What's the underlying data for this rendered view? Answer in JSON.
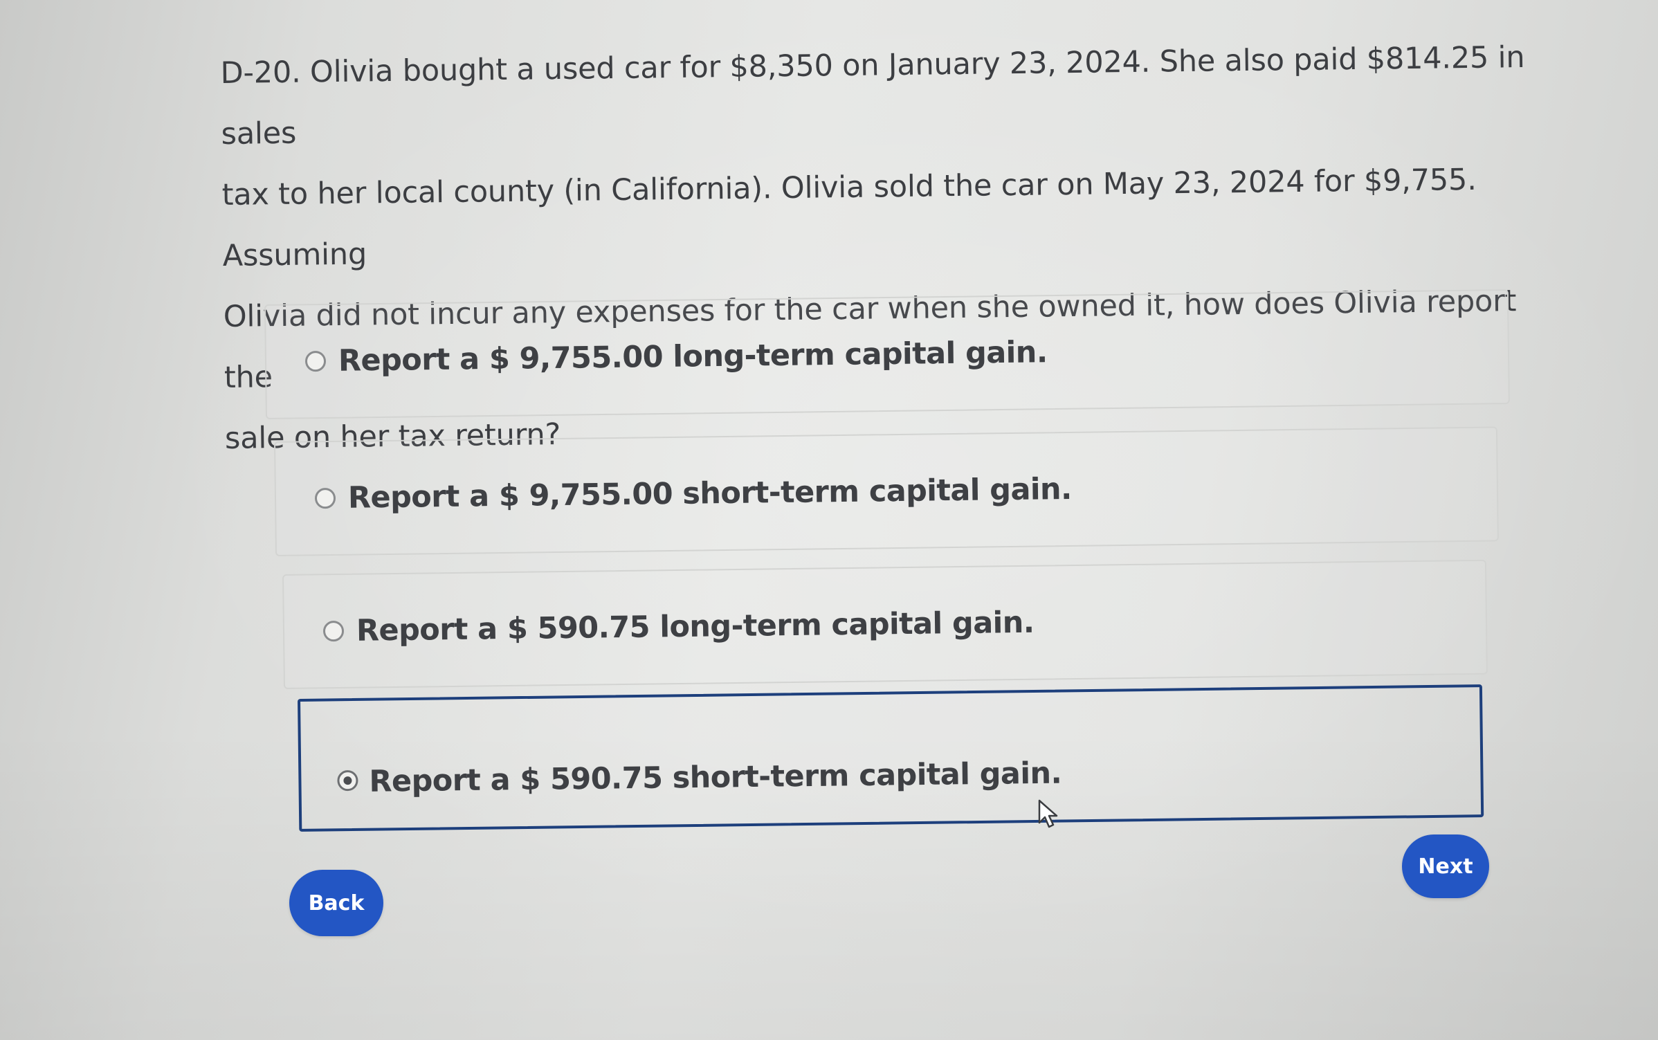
{
  "question": {
    "lines": [
      "D-20. Olivia bought a used car for $8,350 on January 23, 2024. She also paid $814.25 in sales",
      "tax to her local county (in California). Olivia sold the car on May 23, 2024 for $9,755. Assuming",
      "Olivia did not incur any expenses for the car when she owned it, how does Olivia report the",
      "sale on her tax return?"
    ]
  },
  "options": [
    {
      "label": "Report a $ 9,755.00 long-term capital gain.",
      "selected": false
    },
    {
      "label": "Report a $ 9,755.00 short-term capital gain.",
      "selected": false
    },
    {
      "label": "Report a $ 590.75 long-term capital gain.",
      "selected": false
    },
    {
      "label": "Report a $ 590.75 short-term capital gain.",
      "selected": true
    }
  ],
  "buttons": {
    "back_label": "Back",
    "next_label": "Next"
  },
  "colors": {
    "accent": "#2356c4",
    "selected_border": "#1d3f7c",
    "text": "#3c3e42"
  },
  "icons": {
    "cursor": "arrow-cursor-icon"
  }
}
